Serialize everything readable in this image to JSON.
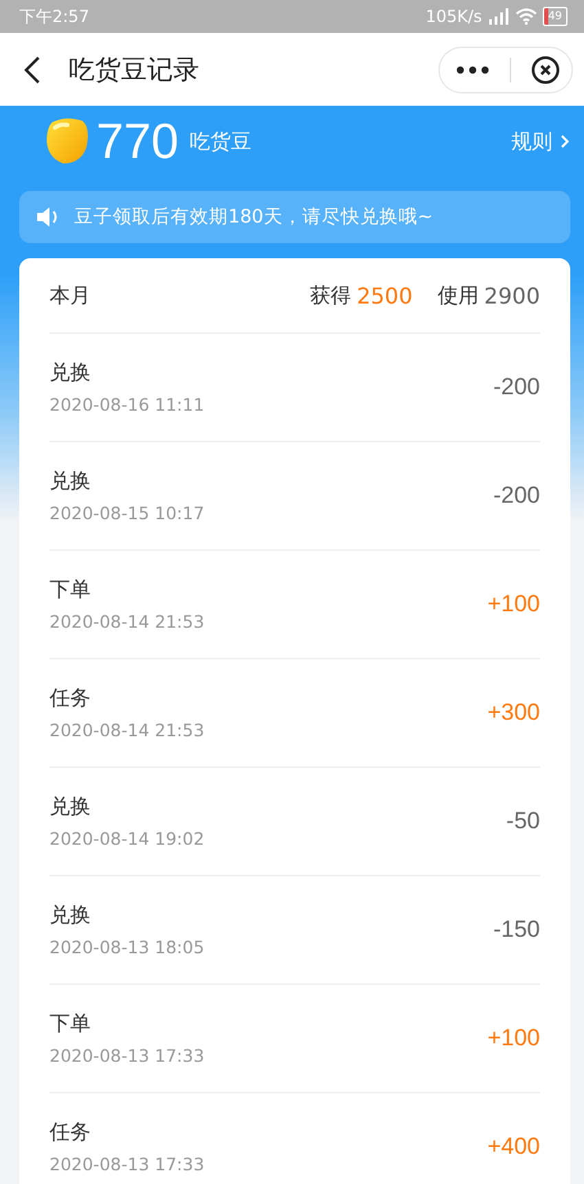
{
  "status_bar": {
    "time": "下午2:57",
    "speed": "105K/s",
    "battery": "49"
  },
  "header": {
    "title": "吃货豆记录"
  },
  "balance": {
    "amount": "770",
    "unit": "吃货豆",
    "rules_link": "规则"
  },
  "notice": {
    "text": "豆子领取后有效期180天，请尽快兑换哦~"
  },
  "summary": {
    "label": "本月",
    "earned_label": "获得",
    "earned": "2500",
    "used_label": "使用",
    "used": "2900"
  },
  "records": [
    {
      "title": "兑换",
      "time": "2020-08-16 11:11",
      "amount": "-200",
      "kind": "spend"
    },
    {
      "title": "兑换",
      "time": "2020-08-15 10:17",
      "amount": "-200",
      "kind": "spend"
    },
    {
      "title": "下单",
      "time": "2020-08-14 21:53",
      "amount": "+100",
      "kind": "earn"
    },
    {
      "title": "任务",
      "time": "2020-08-14 21:53",
      "amount": "+300",
      "kind": "earn"
    },
    {
      "title": "兑换",
      "time": "2020-08-14 19:02",
      "amount": "-50",
      "kind": "spend"
    },
    {
      "title": "兑换",
      "time": "2020-08-13 18:05",
      "amount": "-150",
      "kind": "spend"
    },
    {
      "title": "下单",
      "time": "2020-08-13 17:33",
      "amount": "+100",
      "kind": "earn"
    },
    {
      "title": "任务",
      "time": "2020-08-13 17:33",
      "amount": "+400",
      "kind": "earn"
    }
  ]
}
